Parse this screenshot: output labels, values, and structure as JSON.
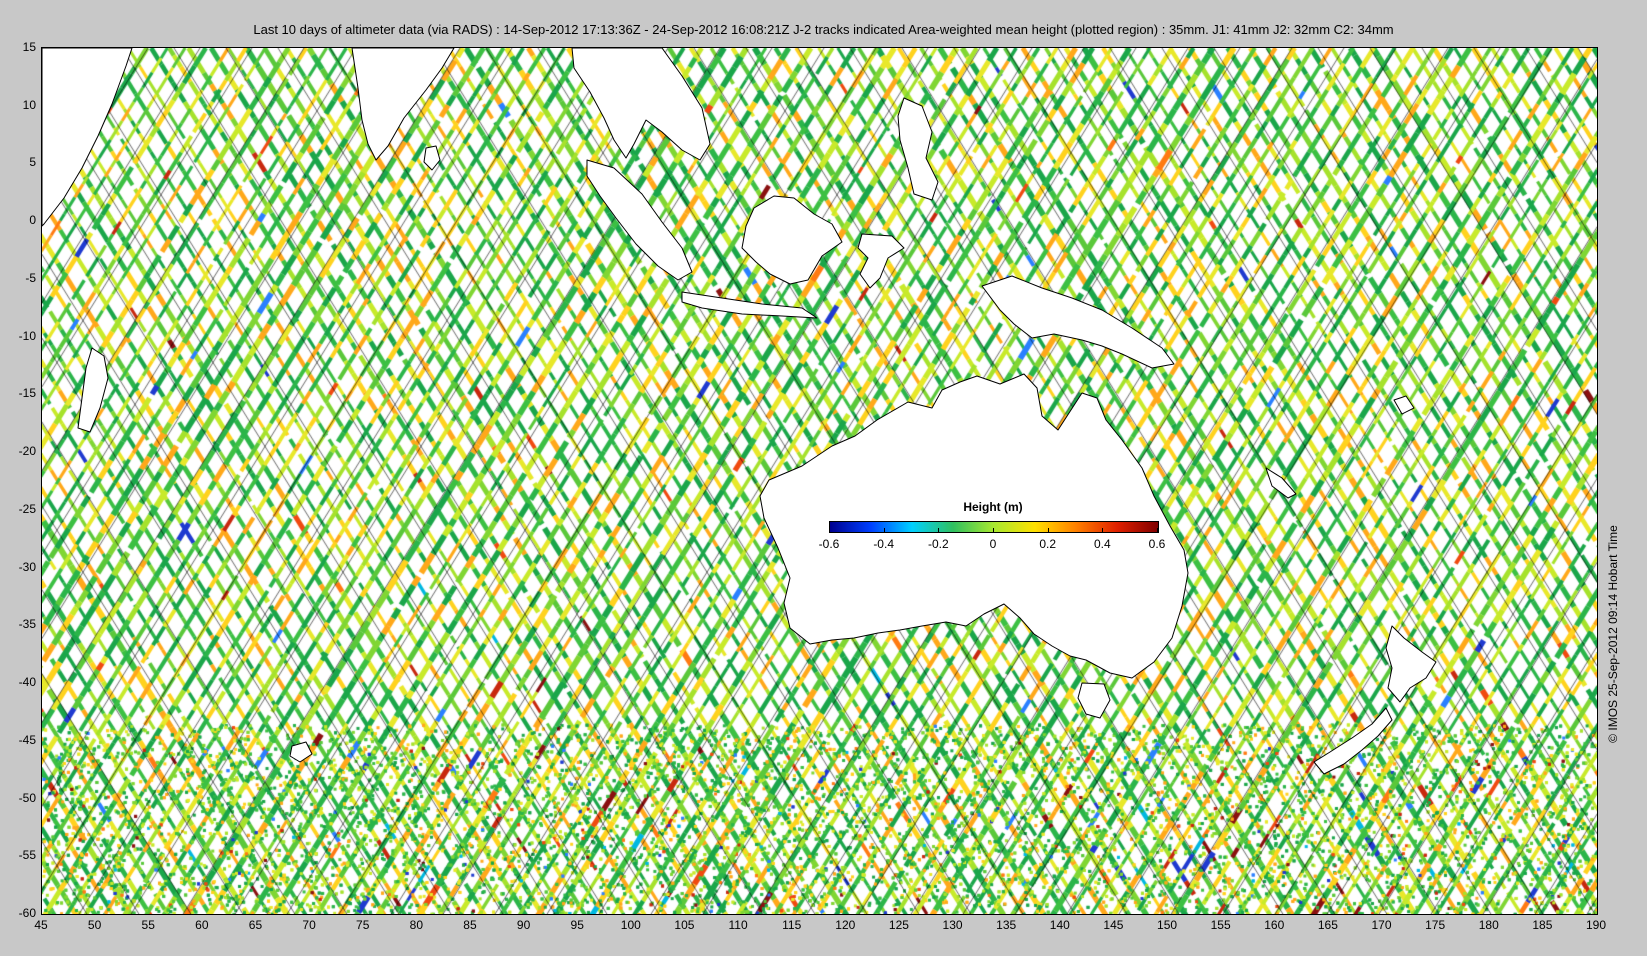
{
  "title": "Last 10 days of altimeter data (via RADS) : 14-Sep-2012 17:13:36Z - 24-Sep-2012 16:08:21Z  J-2 tracks indicated  Area-weighted mean height (plotted region) : 35mm.  J1: 41mm  J2: 32mm  C2: 34mm",
  "credit": "© IMOS 25-Sep-2012 09:14 Hobart Time",
  "colorbar": {
    "title": "Height (m)",
    "ticks": [
      "-0.6",
      "-0.4",
      "-0.2",
      "0",
      "0.2",
      "0.4",
      "0.6"
    ],
    "range": [
      -0.6,
      0.6
    ],
    "colormap": [
      "#00008f",
      "#0040ff",
      "#00d0ff",
      "#30c060",
      "#a8e830",
      "#ffe000",
      "#ff8000",
      "#e02000",
      "#800000"
    ]
  },
  "axes": {
    "lon_range": [
      45,
      190
    ],
    "lat_range": [
      -60,
      15
    ],
    "x_ticks": [
      "45",
      "50",
      "55",
      "60",
      "65",
      "70",
      "75",
      "80",
      "85",
      "90",
      "95",
      "100",
      "105",
      "110",
      "115",
      "120",
      "125",
      "130",
      "135",
      "140",
      "145",
      "150",
      "155",
      "160",
      "165",
      "170",
      "175",
      "180",
      "185",
      "190"
    ],
    "y_ticks": [
      "15",
      "10",
      "5",
      "0",
      "-5",
      "-10",
      "-15",
      "-20",
      "-25",
      "-30",
      "-35",
      "-40",
      "-45",
      "-50",
      "-55",
      "-60"
    ]
  },
  "colors": {
    "background": "#c8c8c8",
    "ocean_base": "#4cbf3c",
    "land": "#ffffff",
    "coastline": "#000000",
    "track_line": "#000000"
  }
}
